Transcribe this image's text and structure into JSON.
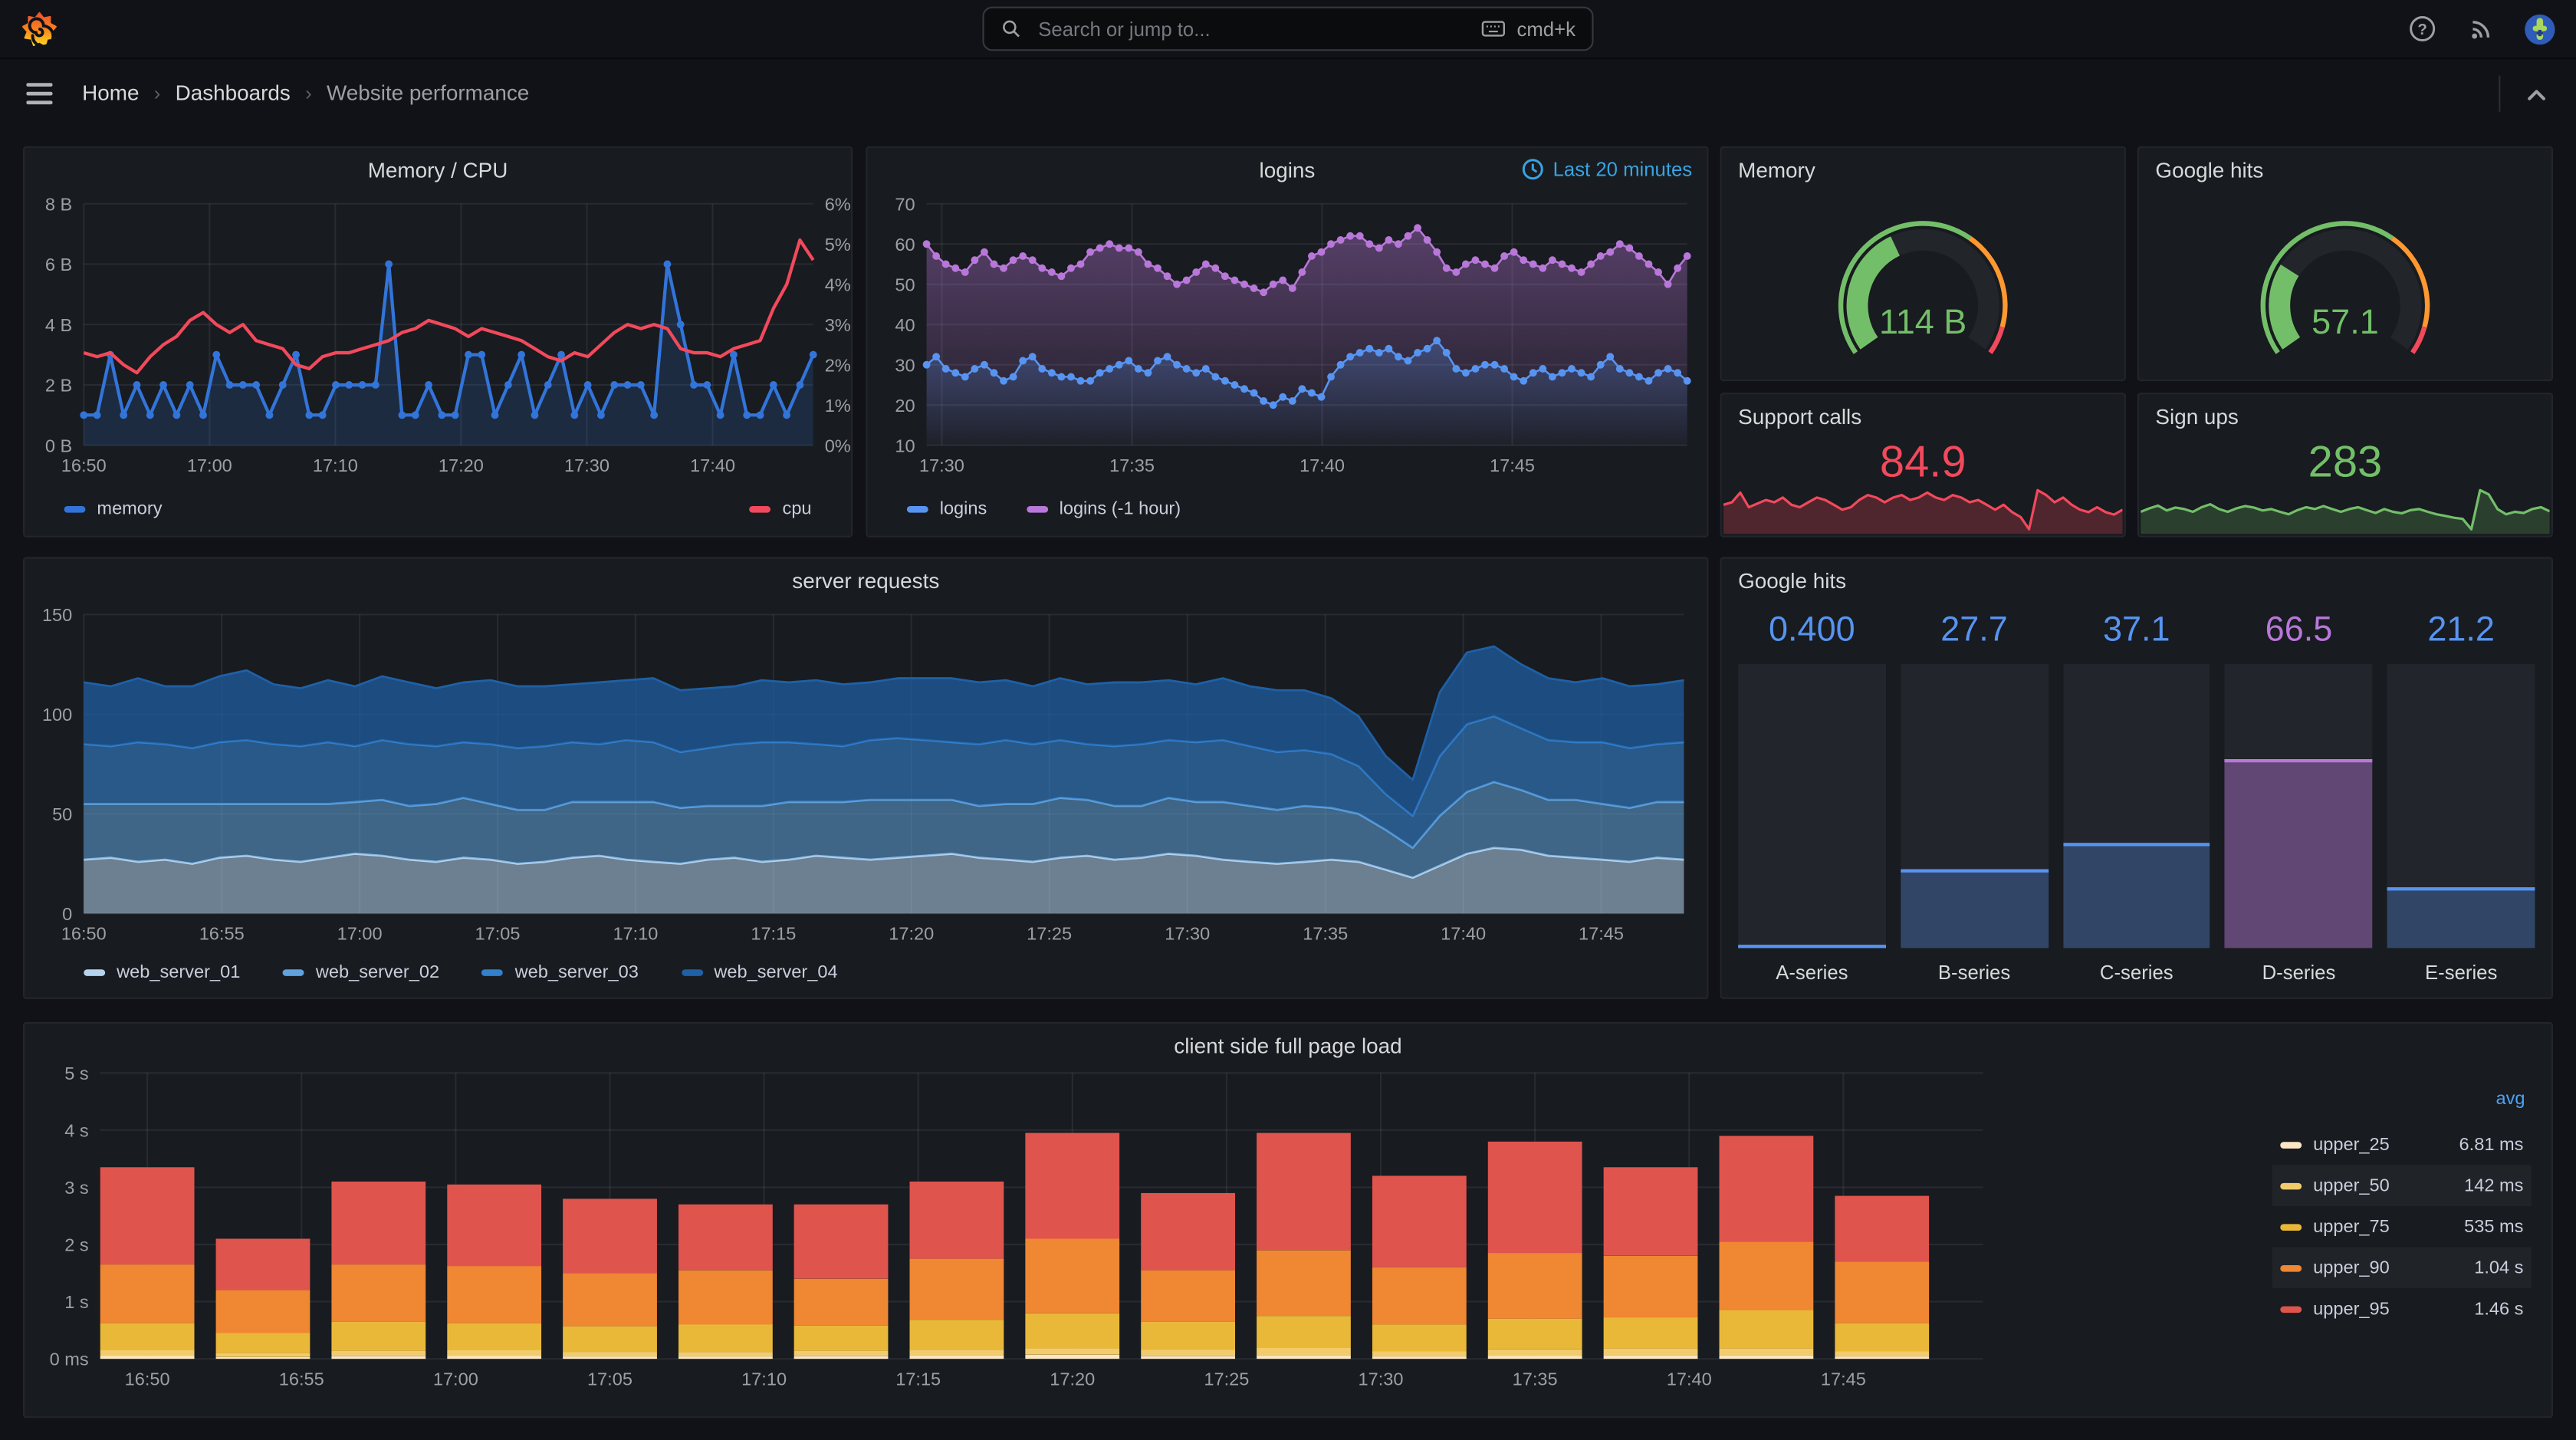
{
  "app": {
    "search_placeholder": "Search or jump to...",
    "search_shortcut": "cmd+k"
  },
  "breadcrumb": {
    "home": "Home",
    "dashboards": "Dashboards",
    "current": "Website performance",
    "separator": "›"
  },
  "panels": {
    "memory_cpu": {
      "title": "Memory / CPU"
    },
    "logins": {
      "title": "logins",
      "time_range": "Last 20 minutes"
    },
    "memory_gauge": {
      "title": "Memory",
      "value": "114 B"
    },
    "google_hits_gauge": {
      "title": "Google hits",
      "value": "57.1"
    },
    "support_calls": {
      "title": "Support calls",
      "value": "84.9"
    },
    "sign_ups": {
      "title": "Sign ups",
      "value": "283"
    },
    "server_requests": {
      "title": "server requests"
    },
    "google_hits_bars": {
      "title": "Google hits"
    },
    "client_load": {
      "title": "client side full page load"
    }
  },
  "chart_data": [
    {
      "id": "memory_cpu",
      "type": "line",
      "title": "Memory / CPU",
      "x_ticks": {
        "labels": [
          "16:50",
          "17:00",
          "17:10",
          "17:20",
          "17:30",
          "17:40"
        ],
        "fracs": [
          0,
          0.1724,
          0.3448,
          0.5172,
          0.6897,
          0.8621
        ]
      },
      "y": {
        "ticks": [
          "0 B",
          "2 B",
          "4 B",
          "6 B",
          "8 B"
        ],
        "lim": [
          0,
          8
        ],
        "unit": "bytes"
      },
      "y2": {
        "ticks": [
          "0%",
          "1%",
          "2%",
          "3%",
          "4%",
          "5%",
          "6%"
        ],
        "lim": [
          0,
          6
        ],
        "unit": "percent"
      },
      "series": [
        {
          "name": "memory",
          "axis": "left",
          "color": "#3274D9",
          "fill": "rgba(50,116,217,0.18)",
          "markers": true,
          "values": [
            1,
            1,
            3,
            1,
            2,
            1,
            2,
            1,
            2,
            1,
            3,
            2,
            2,
            2,
            1,
            2,
            3,
            1,
            1,
            2,
            2,
            2,
            2,
            6,
            1,
            1,
            2,
            1,
            1,
            3,
            3,
            1,
            2,
            3,
            1,
            2,
            3,
            1,
            2,
            1,
            2,
            2,
            2,
            1,
            6,
            4,
            2,
            2,
            1,
            3,
            1,
            1,
            2,
            1,
            2,
            3
          ]
        },
        {
          "name": "cpu",
          "axis": "right",
          "color": "#F2495C",
          "markers": false,
          "values": [
            2.3,
            2.2,
            2.3,
            2.0,
            1.8,
            2.2,
            2.5,
            2.7,
            3.1,
            3.3,
            3.0,
            2.8,
            3.0,
            2.6,
            2.5,
            2.4,
            2.0,
            1.9,
            2.2,
            2.3,
            2.3,
            2.4,
            2.5,
            2.6,
            2.8,
            2.9,
            3.1,
            3.0,
            2.9,
            2.7,
            2.9,
            2.8,
            2.7,
            2.6,
            2.4,
            2.2,
            2.1,
            2.3,
            2.2,
            2.5,
            2.8,
            3.0,
            2.9,
            3.0,
            2.9,
            2.4,
            2.3,
            2.3,
            2.2,
            2.4,
            2.5,
            2.6,
            3.4,
            4.0,
            5.1,
            4.6
          ]
        }
      ]
    },
    {
      "id": "logins",
      "type": "scatter",
      "title": "logins",
      "time_range": "Last 20 minutes",
      "x_ticks": {
        "labels": [
          "17:30",
          "17:35",
          "17:40",
          "17:45"
        ],
        "fracs": [
          0.02,
          0.27,
          0.52,
          0.77
        ]
      },
      "y": {
        "ticks": [
          "10",
          "20",
          "30",
          "40",
          "50",
          "60",
          "70"
        ],
        "lim": [
          10,
          70
        ]
      },
      "series": [
        {
          "name": "logins (-1 hour)",
          "color": "#B877D9",
          "grad": [
            "rgba(184,119,217,0.40)",
            "rgba(184,119,217,0.03)"
          ],
          "values": [
            60,
            57,
            55,
            54,
            53,
            56,
            58,
            55,
            54,
            56,
            57,
            56,
            54,
            53,
            52,
            54,
            55,
            58,
            59,
            60,
            59,
            59,
            58,
            55,
            54,
            52,
            50,
            51,
            53,
            55,
            54,
            52,
            51,
            50,
            49,
            48,
            50,
            51,
            49,
            53,
            57,
            58,
            60,
            61,
            62,
            62,
            60,
            59,
            61,
            60,
            62,
            64,
            61,
            58,
            54,
            53,
            55,
            56,
            55,
            54,
            57,
            58,
            56,
            55,
            54,
            56,
            55,
            54,
            53,
            55,
            57,
            58,
            60,
            59,
            57,
            55,
            53,
            50,
            54,
            57
          ]
        },
        {
          "name": "logins",
          "color": "#5794F2",
          "grad": [
            "rgba(87,148,242,0.28)",
            "rgba(87,148,242,0.02)"
          ],
          "values": [
            30,
            32,
            29,
            28,
            27,
            29,
            30,
            28,
            26,
            27,
            31,
            32,
            29,
            28,
            27,
            27,
            26,
            26,
            28,
            29,
            30,
            31,
            29,
            28,
            31,
            32,
            30,
            29,
            28,
            29,
            27,
            26,
            25,
            24,
            23,
            21,
            20,
            22,
            21,
            24,
            23,
            22,
            27,
            30,
            32,
            33,
            34,
            33,
            34,
            32,
            31,
            33,
            34,
            36,
            33,
            29,
            28,
            29,
            30,
            30,
            29,
            27,
            26,
            28,
            29,
            27,
            28,
            29,
            28,
            27,
            30,
            32,
            29,
            28,
            27,
            26,
            28,
            29,
            28,
            26
          ]
        }
      ],
      "legend_order": [
        "logins",
        "logins (-1 hour)"
      ]
    },
    {
      "id": "memory_gauge",
      "type": "gauge",
      "title": "Memory",
      "value_text": "114 B",
      "fraction": 0.4,
      "color": "#73BF69",
      "thresholds": [
        {
          "to": 0.64,
          "color": "#73BF69"
        },
        {
          "to": 0.92,
          "color": "#FF9830"
        },
        {
          "to": 1,
          "color": "#F2495C"
        }
      ]
    },
    {
      "id": "google_hits_gauge",
      "type": "gauge",
      "title": "Google hits",
      "value_text": "57.1",
      "fraction": 0.27,
      "color": "#73BF69",
      "thresholds": [
        {
          "to": 0.64,
          "color": "#73BF69"
        },
        {
          "to": 0.92,
          "color": "#FF9830"
        },
        {
          "to": 1,
          "color": "#F2495C"
        }
      ]
    },
    {
      "id": "support_calls",
      "type": "stat",
      "title": "Support calls",
      "value_text": "84.9",
      "color": "#F2495C",
      "fill": "rgba(242,73,92,0.25)",
      "values": [
        78,
        80,
        88,
        76,
        79,
        82,
        80,
        84,
        78,
        76,
        80,
        84,
        82,
        78,
        74,
        76,
        82,
        86,
        84,
        80,
        84,
        86,
        82,
        84,
        88,
        84,
        82,
        86,
        84,
        80,
        82,
        78,
        74,
        78,
        72,
        68,
        58,
        90,
        86,
        80,
        84,
        78,
        74,
        72,
        76,
        72,
        70,
        74
      ]
    },
    {
      "id": "sign_ups",
      "type": "stat",
      "title": "Sign ups",
      "value_text": "283",
      "color": "#73BF69",
      "fill": "rgba(115,191,105,0.22)",
      "values": [
        270,
        282,
        292,
        275,
        285,
        280,
        270,
        286,
        296,
        280,
        270,
        282,
        290,
        285,
        275,
        280,
        270,
        262,
        276,
        286,
        280,
        290,
        280,
        270,
        280,
        286,
        276,
        266,
        280,
        270,
        265,
        276,
        280,
        270,
        262,
        256,
        250,
        246,
        210,
        345,
        330,
        280,
        262,
        270,
        266,
        280,
        286,
        272
      ]
    },
    {
      "id": "server_requests",
      "type": "stacked_area",
      "title": "server requests",
      "x_ticks": {
        "labels": [
          "16:50",
          "16:55",
          "17:00",
          "17:05",
          "17:10",
          "17:15",
          "17:20",
          "17:25",
          "17:30",
          "17:35",
          "17:40",
          "17:45"
        ],
        "fracs": [
          0,
          0.0862,
          0.1724,
          0.2586,
          0.3448,
          0.431,
          0.5172,
          0.6034,
          0.6897,
          0.7759,
          0.8621,
          0.9483
        ]
      },
      "y": {
        "ticks": [
          "0",
          "50",
          "100",
          "150"
        ],
        "lim": [
          0,
          150
        ]
      },
      "series": [
        {
          "name": "web_server_01",
          "color": "#B5D3EF",
          "fill": "rgba(181,211,239,0.55)",
          "values": [
            27,
            28,
            26,
            27,
            25,
            28,
            29,
            27,
            26,
            28,
            30,
            29,
            27,
            26,
            28,
            27,
            25,
            26,
            28,
            29,
            27,
            26,
            25,
            27,
            28,
            26,
            27,
            29,
            28,
            27,
            28,
            29,
            30,
            28,
            27,
            26,
            28,
            29,
            27,
            28,
            30,
            29,
            27,
            26,
            25,
            26,
            27,
            26,
            22,
            18,
            24,
            30,
            33,
            32,
            29,
            28,
            27,
            26,
            28,
            27
          ]
        },
        {
          "name": "web_server_02",
          "color": "#61A2DC",
          "fill": "rgba(97,162,220,0.55)",
          "values": [
            28,
            27,
            29,
            28,
            30,
            27,
            26,
            28,
            29,
            27,
            26,
            28,
            27,
            29,
            30,
            28,
            27,
            26,
            28,
            27,
            29,
            30,
            28,
            27,
            26,
            28,
            29,
            27,
            28,
            30,
            29,
            28,
            27,
            26,
            28,
            29,
            30,
            28,
            27,
            26,
            28,
            27,
            29,
            28,
            27,
            28,
            26,
            24,
            20,
            15,
            25,
            31,
            33,
            30,
            28,
            29,
            28,
            27,
            28,
            29
          ]
        },
        {
          "name": "web_server_03",
          "color": "#3380CC",
          "fill": "rgba(51,128,204,0.62)",
          "values": [
            30,
            29,
            31,
            30,
            28,
            31,
            32,
            30,
            29,
            31,
            28,
            30,
            31,
            29,
            28,
            30,
            31,
            32,
            30,
            29,
            31,
            30,
            28,
            29,
            31,
            32,
            30,
            29,
            28,
            30,
            31,
            30,
            29,
            31,
            32,
            30,
            29,
            28,
            30,
            31,
            29,
            30,
            31,
            30,
            29,
            28,
            27,
            24,
            18,
            16,
            30,
            34,
            33,
            31,
            30,
            29,
            31,
            30,
            29,
            30
          ]
        },
        {
          "name": "web_server_04",
          "color": "#1F60A6",
          "fill": "rgba(31,96,166,0.72)",
          "values": [
            31,
            30,
            32,
            29,
            31,
            33,
            35,
            30,
            29,
            31,
            30,
            32,
            31,
            29,
            30,
            32,
            31,
            30,
            29,
            31,
            30,
            32,
            31,
            30,
            29,
            31,
            30,
            32,
            31,
            29,
            30,
            31,
            32,
            31,
            30,
            29,
            31,
            30,
            32,
            31,
            30,
            29,
            31,
            30,
            31,
            30,
            28,
            25,
            19,
            18,
            32,
            36,
            35,
            32,
            31,
            30,
            32,
            31,
            30,
            31
          ]
        }
      ]
    },
    {
      "id": "google_hits_bars",
      "type": "bar_gauge",
      "title": "Google hits",
      "max": 100,
      "bars": [
        {
          "label": "A-series",
          "value": 0.4,
          "value_text": "0.400",
          "color": "#5794F2",
          "fill": "rgba(87,148,242,0.30)"
        },
        {
          "label": "B-series",
          "value": 27.7,
          "value_text": "27.7",
          "color": "#5794F2",
          "fill": "rgba(87,148,242,0.30)"
        },
        {
          "label": "C-series",
          "value": 37.1,
          "value_text": "37.1",
          "color": "#5794F2",
          "fill": "rgba(87,148,242,0.30)"
        },
        {
          "label": "D-series",
          "value": 66.5,
          "value_text": "66.5",
          "color": "#B877D9",
          "fill": "rgba(184,119,217,0.42)"
        },
        {
          "label": "E-series",
          "value": 21.2,
          "value_text": "21.2",
          "color": "#5794F2",
          "fill": "rgba(87,148,242,0.30)"
        }
      ]
    },
    {
      "id": "client_load",
      "type": "stacked_bar",
      "title": "client side full page load",
      "x_span_minutes": 58,
      "bar_pitch_minutes": 3.75,
      "bar_width_minutes": 2.9,
      "x_ticks": {
        "labels": [
          "16:50",
          "16:55",
          "17:00",
          "17:05",
          "17:10",
          "17:15",
          "17:20",
          "17:25",
          "17:30",
          "17:35",
          "17:40",
          "17:45"
        ],
        "minutes": [
          0,
          5,
          10,
          15,
          20,
          25,
          30,
          35,
          40,
          45,
          50,
          55
        ]
      },
      "y": {
        "ticks": [
          "0 ms",
          "1 s",
          "2 s",
          "3 s",
          "4 s",
          "5 s"
        ],
        "lim": [
          0,
          5
        ]
      },
      "layers": [
        "upper_25",
        "upper_50",
        "upper_75",
        "upper_90",
        "upper_95"
      ],
      "layer_colors": [
        "#FBE6C5",
        "#F2CC6C",
        "#EAB839",
        "#EF8733",
        "#E0544E"
      ],
      "bars_cumulative_seconds": [
        [
          0.05,
          0.15,
          0.62,
          1.65,
          3.35
        ],
        [
          0.03,
          0.1,
          0.45,
          1.2,
          2.1
        ],
        [
          0.05,
          0.14,
          0.65,
          1.65,
          3.1
        ],
        [
          0.05,
          0.15,
          0.62,
          1.62,
          3.05
        ],
        [
          0.04,
          0.12,
          0.57,
          1.5,
          2.8
        ],
        [
          0.04,
          0.12,
          0.6,
          1.55,
          2.7
        ],
        [
          0.05,
          0.14,
          0.58,
          1.4,
          2.7
        ],
        [
          0.06,
          0.16,
          0.68,
          1.75,
          3.1
        ],
        [
          0.07,
          0.18,
          0.8,
          2.1,
          3.95
        ],
        [
          0.05,
          0.16,
          0.65,
          1.55,
          2.9
        ],
        [
          0.06,
          0.2,
          0.75,
          1.9,
          3.95
        ],
        [
          0.04,
          0.13,
          0.6,
          1.6,
          3.2
        ],
        [
          0.05,
          0.17,
          0.7,
          1.85,
          3.8
        ],
        [
          0.06,
          0.18,
          0.72,
          1.8,
          3.35
        ],
        [
          0.06,
          0.18,
          0.85,
          2.05,
          3.9
        ],
        [
          0.04,
          0.13,
          0.62,
          1.7,
          2.85
        ]
      ],
      "legend": {
        "header": "avg",
        "rows": [
          {
            "label": "upper_25",
            "value": "6.81 ms",
            "color": "#FBE6C5"
          },
          {
            "label": "upper_50",
            "value": "142 ms",
            "color": "#F2CC6C"
          },
          {
            "label": "upper_75",
            "value": "535 ms",
            "color": "#EAB839"
          },
          {
            "label": "upper_90",
            "value": "1.04 s",
            "color": "#EF8733"
          },
          {
            "label": "upper_95",
            "value": "1.46 s",
            "color": "#E0544E"
          }
        ],
        "striped_rows": [
          1,
          3
        ]
      }
    }
  ]
}
